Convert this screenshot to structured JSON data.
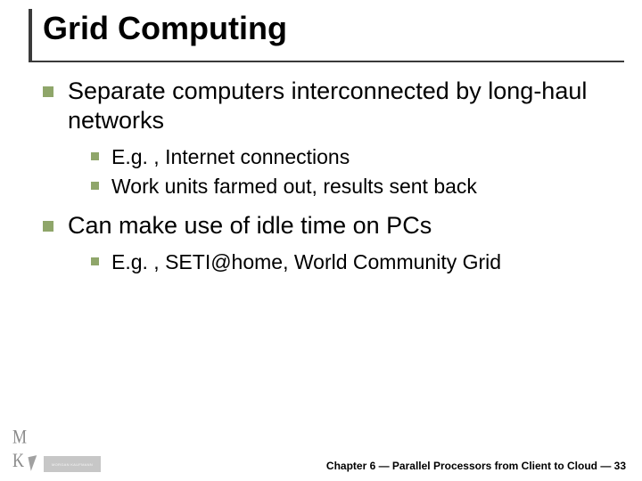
{
  "title": "Grid Computing",
  "bullets": [
    {
      "text": "Separate computers interconnected by long-haul networks",
      "children": [
        {
          "text": "E.g. , Internet connections"
        },
        {
          "text": "Work units farmed out, results sent back"
        }
      ]
    },
    {
      "text": "Can make use of idle time on PCs",
      "children": [
        {
          "text": "E.g. , SETI@home, World Community Grid"
        }
      ]
    }
  ],
  "publisher": "MORGAN KAUFMANN",
  "footer": "Chapter 6 — Parallel Processors from Client to Cloud — 33",
  "colors": {
    "bullet": "#8fa66a",
    "rule": "#3a3a3a"
  }
}
